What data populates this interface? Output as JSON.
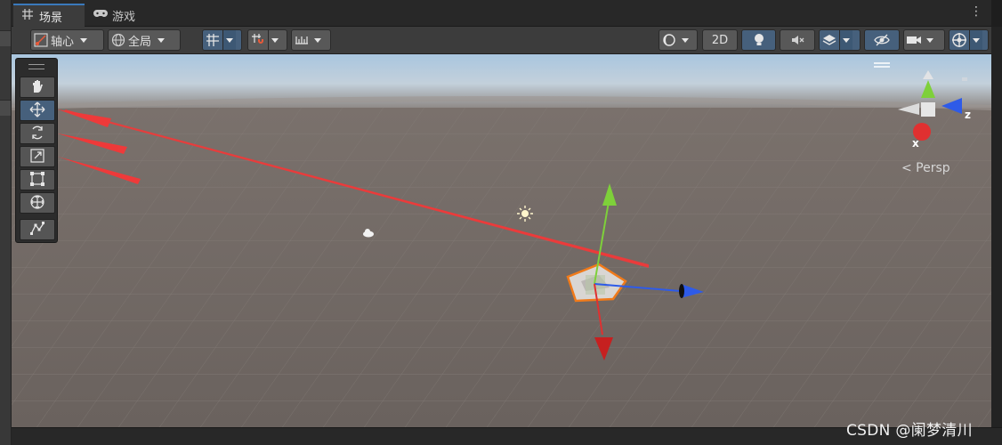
{
  "tabs": [
    {
      "label": "场景",
      "icon": "grid-icon",
      "active": true
    },
    {
      "label": "游戏",
      "icon": "gamepad-icon",
      "active": false
    }
  ],
  "toolbar": {
    "pivot_label": "轴心",
    "global_label": "全局",
    "two_d_label": "2D"
  },
  "tool_palette": {
    "tools": [
      "hand-tool",
      "move-tool",
      "rotate-tool",
      "scale-tool",
      "rect-tool",
      "transform-tool",
      "custom-tool"
    ],
    "active_tool": "move-tool"
  },
  "gizmo": {
    "axes": [
      "y",
      "z",
      "x"
    ],
    "x_label": "x",
    "z_label": "z",
    "projection_label": "< Persp"
  },
  "watermark": "CSDN @阑梦清川",
  "colors": {
    "accent": "#3a79bb",
    "active_button": "#46607c",
    "x_axis": "#e03030",
    "y_axis": "#7ed03a",
    "z_axis": "#2e5be8",
    "annotation_arrow": "#ee3a3a",
    "selection_outline": "#f07a1a"
  }
}
